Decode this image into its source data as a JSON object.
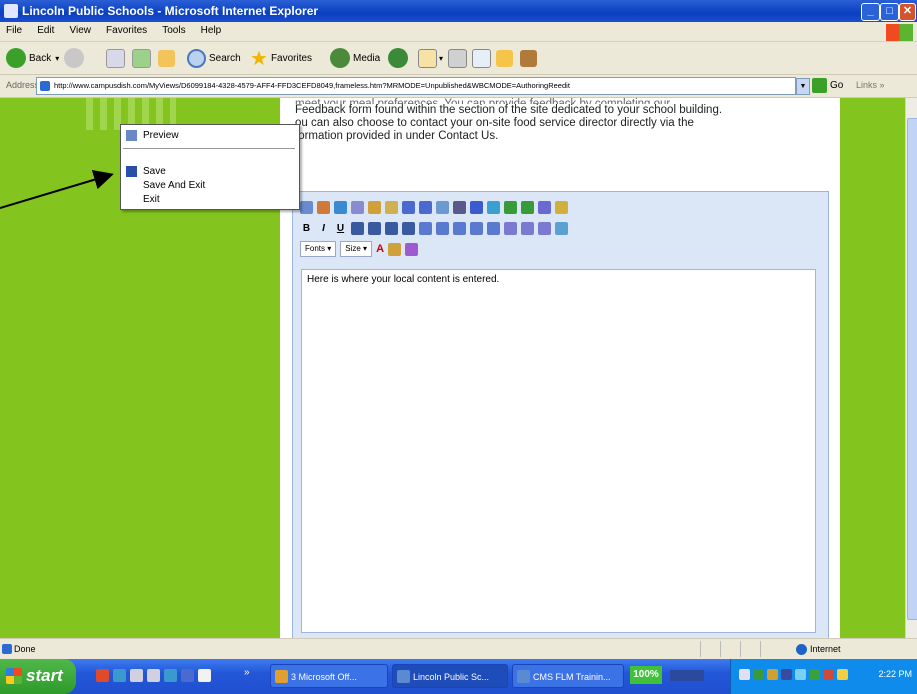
{
  "window": {
    "title": "Lincoln Public Schools - Microsoft Internet Explorer"
  },
  "menu": {
    "items": [
      "File",
      "Edit",
      "View",
      "Favorites",
      "Tools",
      "Help"
    ]
  },
  "toolbar": {
    "back_label": "Back",
    "search_label": "Search",
    "favorites_label": "Favorites",
    "media_label": "Media"
  },
  "address": {
    "label": "Address",
    "url": "http://www.campusdish.com/MyViews/D6099184-4328-4579-AFF4-FFD3CEFD8049,frameless.htm?MRMODE=Unpublished&WBCMODE=AuthoringReedit",
    "go_label": "Go",
    "links_label": "Links"
  },
  "content": {
    "para_cut": "meet your meal preferences. You can provide feedback by completing our",
    "para_line1": "Feedback form found within the section of the site dedicated to your school building.",
    "para_line2": "ou can also choose to contact your on-site food service director directly via the",
    "para_line3": "formation provided in under Contact Us."
  },
  "editor": {
    "fonts_label": "Fonts",
    "size_label": "Size",
    "body_text": "Here is where your local content is entered."
  },
  "context_menu": {
    "preview": "Preview",
    "save": "Save",
    "save_and_exit": "Save And Exit",
    "exit": "Exit"
  },
  "status": {
    "text": "Done",
    "zone": "Internet"
  },
  "taskbar": {
    "start_label": "start",
    "tasks": [
      "3 Microsoft Off...",
      "Lincoln Public Sc...",
      "CMS FLM Trainin..."
    ],
    "zoom": "100%",
    "clock": "2:22 PM"
  },
  "colors": {
    "page_green": "#83c51e",
    "xp_blue": "#0a3fbf",
    "editor_blue": "#dbe6f7"
  }
}
